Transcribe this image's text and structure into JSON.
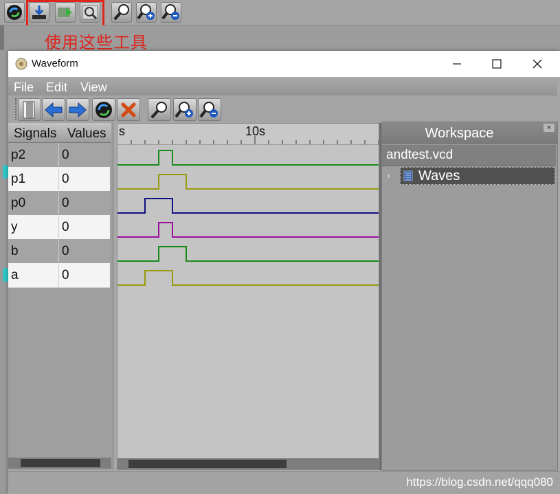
{
  "annotation": {
    "text": "使用这些工具"
  },
  "background_toolbar": {
    "buttons": [
      {
        "icon": "reload-icon"
      },
      {
        "icon": "download-icon"
      },
      {
        "icon": "play-icon"
      },
      {
        "icon": "search-icon"
      },
      {
        "icon": "zoom-icon"
      },
      {
        "icon": "zoom-in-icon"
      },
      {
        "icon": "zoom-out-icon"
      }
    ]
  },
  "window": {
    "title": "Waveform",
    "controls": {
      "minimize": "—",
      "maximize": "☐",
      "close": "✕"
    }
  },
  "menu": {
    "file": "File",
    "edit": "Edit",
    "view": "View"
  },
  "toolbar": {
    "buttons": [
      {
        "icon": "door-exit-icon"
      },
      {
        "icon": "back-arrow-icon"
      },
      {
        "icon": "forward-arrow-icon"
      },
      {
        "icon": "reload-icon"
      },
      {
        "icon": "delete-x-icon"
      },
      {
        "icon": "zoom-icon"
      },
      {
        "icon": "zoom-in-icon"
      },
      {
        "icon": "zoom-out-icon"
      }
    ]
  },
  "signals": {
    "header_signals": "Signals",
    "header_values": "Values",
    "rows": [
      {
        "name": "p2",
        "value": "0"
      },
      {
        "name": "p1",
        "value": "0"
      },
      {
        "name": "p0",
        "value": "0"
      },
      {
        "name": "y",
        "value": "0"
      },
      {
        "name": "b",
        "value": "0"
      },
      {
        "name": "a",
        "value": "0"
      }
    ]
  },
  "wave_view": {
    "tick_labels": {
      "start": "s",
      "mid": "10s"
    },
    "traces": [
      {
        "signal": "p2",
        "color": "#1a8a1a",
        "transitions": [
          4,
          6
        ]
      },
      {
        "signal": "p1",
        "color": "#9a9a10",
        "transitions": [
          4,
          8
        ]
      },
      {
        "signal": "p0",
        "color": "#101080",
        "transitions": [
          2,
          6
        ]
      },
      {
        "signal": "y",
        "color": "#9a109a",
        "transitions": [
          4,
          6
        ]
      },
      {
        "signal": "b",
        "color": "#1a8a1a",
        "transitions": [
          4,
          8
        ]
      },
      {
        "signal": "a",
        "color": "#9a9a10",
        "transitions": [
          2,
          6
        ]
      }
    ]
  },
  "workspace": {
    "title": "Workspace",
    "close": "×",
    "file": "andtest.vcd",
    "tree_item": "Waves",
    "expander": "›"
  },
  "status": {
    "text": "https://blog.csdn.net/qqq080"
  }
}
